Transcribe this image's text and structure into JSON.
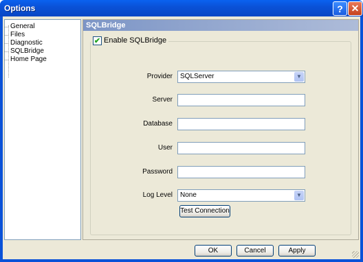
{
  "window": {
    "title": "Options"
  },
  "titlebar_buttons": {
    "help": "?",
    "close": "✕"
  },
  "sidebar": {
    "items": [
      {
        "label": "General"
      },
      {
        "label": "Files"
      },
      {
        "label": "Diagnostic"
      },
      {
        "label": "SQLBridge",
        "selected": true
      },
      {
        "label": "Home Page"
      }
    ]
  },
  "panel": {
    "title": "SQLBridge",
    "enable_checkbox": {
      "label": "Enable SQLBridge",
      "checked": true
    },
    "fields": {
      "provider": {
        "label": "Provider",
        "value": "SQLServer"
      },
      "server": {
        "label": "Server",
        "value": ""
      },
      "database": {
        "label": "Database",
        "value": ""
      },
      "user": {
        "label": "User",
        "value": ""
      },
      "password": {
        "label": "Password",
        "value": ""
      },
      "log_level": {
        "label": "Log Level",
        "value": "None"
      }
    },
    "test_button": "Test Connection"
  },
  "footer": {
    "ok": "OK",
    "cancel": "Cancel",
    "apply": "Apply"
  },
  "colors": {
    "titlebar": "#0a52d8",
    "dialog_bg": "#ece9d8",
    "panel_header": "#7c95c6"
  },
  "icons": {
    "checkmark": "check-icon",
    "dropdown": "chevron-down-icon"
  }
}
